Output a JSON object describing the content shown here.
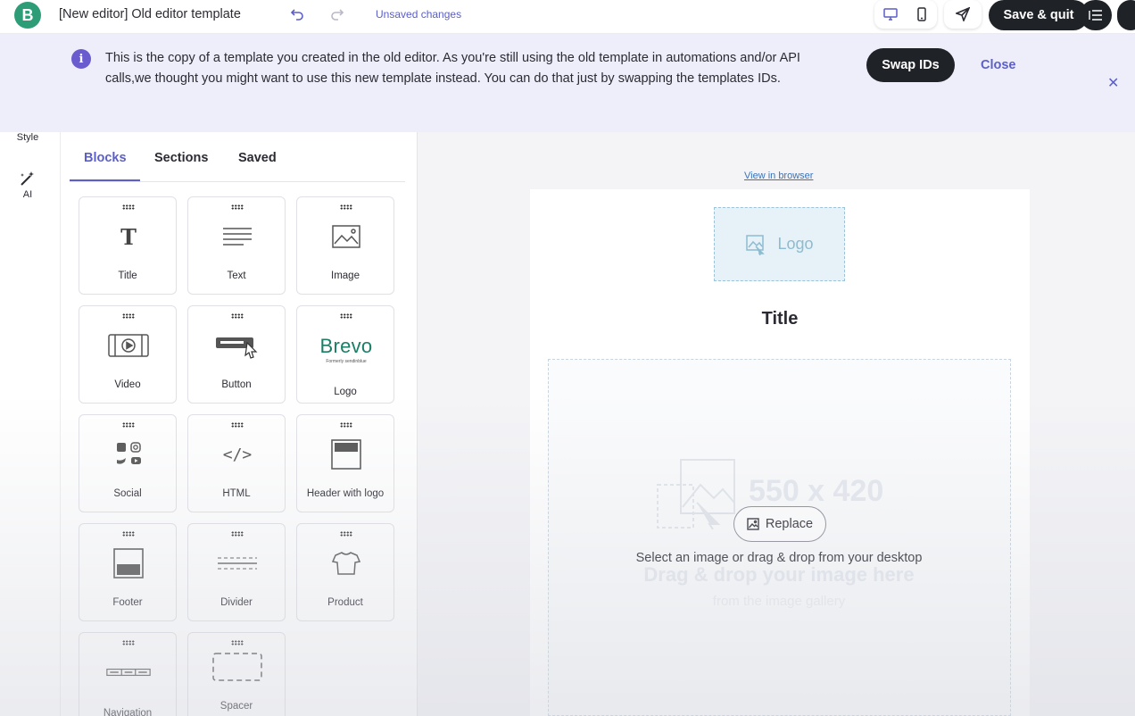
{
  "header": {
    "logo_letter": "B",
    "title": "[New editor] Old editor template",
    "undo_icon": "undo-icon",
    "redo_icon": "redo-icon",
    "status": "Unsaved changes",
    "save_label": "Save & quit"
  },
  "banner": {
    "message": "This is the copy of a template you created in the old editor. As you're still using the old template in automations and/or API calls,we thought you might want to use this new template instead. You can do that just by swapping the templates IDs.",
    "swap_label": "Swap IDs",
    "close_label": "Close",
    "dismiss_glyph": "✕"
  },
  "rail": {
    "style_label": "Style",
    "ai_label": "AI"
  },
  "panel": {
    "tabs": [
      "Blocks",
      "Sections",
      "Saved"
    ],
    "active_tab": "Blocks",
    "blocks": [
      {
        "label": "Title",
        "icon": "title-icon"
      },
      {
        "label": "Text",
        "icon": "text-icon"
      },
      {
        "label": "Image",
        "icon": "image-icon"
      },
      {
        "label": "Video",
        "icon": "video-icon"
      },
      {
        "label": "Button",
        "icon": "button-icon"
      },
      {
        "label": "Logo",
        "icon": "logo-icon",
        "logo_text": "Brevo",
        "logo_sub": "Formerly sendinblue"
      },
      {
        "label": "Social",
        "icon": "social-icon"
      },
      {
        "label": "HTML",
        "icon": "html-icon",
        "glyph": "</>"
      },
      {
        "label": "Header with logo",
        "icon": "header-with-logo-icon"
      },
      {
        "label": "Footer",
        "icon": "footer-icon"
      },
      {
        "label": "Divider",
        "icon": "divider-icon"
      },
      {
        "label": "Product",
        "icon": "product-icon"
      },
      {
        "label": "Navigation",
        "icon": "navigation-icon"
      },
      {
        "label": "Spacer",
        "icon": "spacer-icon"
      }
    ]
  },
  "canvas": {
    "view_in_browser": "View in browser",
    "logo_placeholder": "Logo",
    "title": "Title",
    "image_dimensions": "550 x 420",
    "replace_label": "Replace",
    "select_text": "Select an image or drag & drop from your desktop",
    "drag_drop_text": "Drag & drop your image here",
    "gallery_text": "from the image gallery"
  },
  "colors": {
    "brand_green": "#2d9d78",
    "accent_purple": "#5b5fc7",
    "dark": "#1f2328",
    "banner_bg": "#eeeefa"
  }
}
